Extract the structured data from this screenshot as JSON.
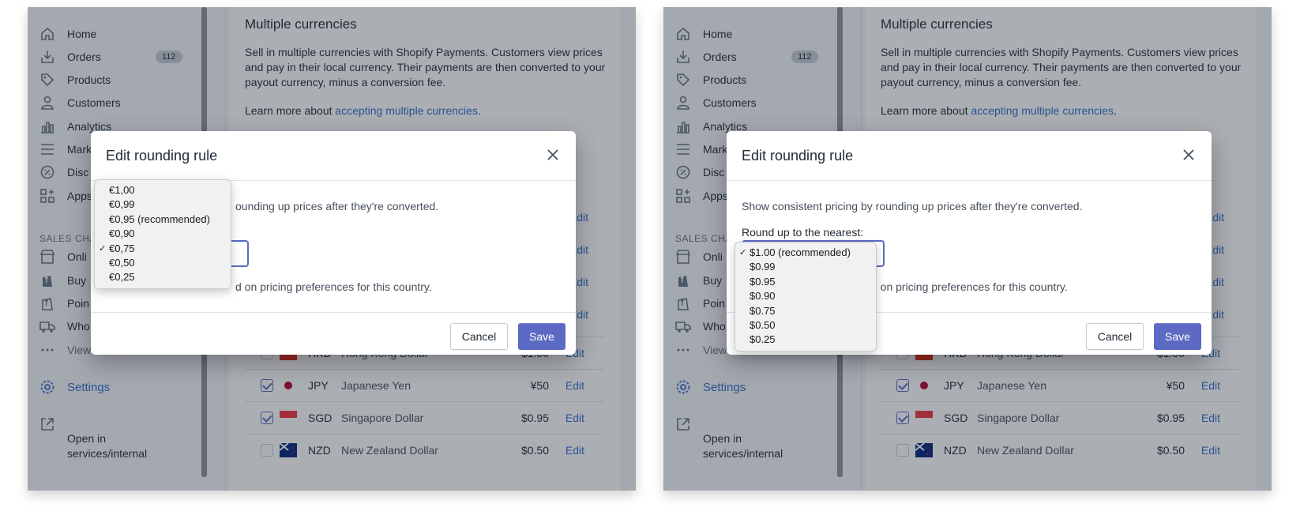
{
  "sidebar": {
    "items": [
      {
        "label": "Home",
        "icon": "home-icon"
      },
      {
        "label": "Orders",
        "icon": "orders-icon",
        "badge": "112"
      },
      {
        "label": "Products",
        "icon": "tag-icon"
      },
      {
        "label": "Customers",
        "icon": "person-icon"
      },
      {
        "label": "Analytics",
        "icon": "bar-chart-icon"
      },
      {
        "label": "Marketing",
        "icon": "menu-icon",
        "visible_label": "Mark"
      },
      {
        "label": "Discounts",
        "icon": "discount-icon",
        "visible_label": "Disc"
      },
      {
        "label": "Apps",
        "icon": "apps-icon"
      }
    ],
    "sales_channels_title": "SALES CHA",
    "channels": [
      {
        "label": "Onli",
        "icon": "store-icon"
      },
      {
        "label": "Buy",
        "icon": "shopify-bag-icon"
      },
      {
        "label": "Poin",
        "icon": "shopify-bag-icon"
      },
      {
        "label": "Who",
        "icon": "truck-icon"
      },
      {
        "label": "View",
        "icon": "ellipsis-icon"
      }
    ],
    "settings_label": "Settings",
    "open_in_label": "Open in services/internal"
  },
  "card": {
    "title": "Multiple currencies",
    "description": "Sell in multiple currencies with Shopify Payments. Customers view prices and pay in their local currency. Their payments are then converted to your payout currency, minus a conversion fee.",
    "learn_prefix": "Learn more about ",
    "learn_link": "accepting multiple currencies",
    "learn_suffix": ".",
    "edit_label": "Edit",
    "rows": [
      {
        "code": "HKD",
        "name": "Hong Kong Dollar",
        "price": "$1.00",
        "checked": false
      },
      {
        "code": "JPY",
        "name": "Japanese Yen",
        "price": "¥50",
        "checked": true
      },
      {
        "code": "SGD",
        "name": "Singapore Dollar",
        "price": "$0.95",
        "checked": true
      },
      {
        "code": "NZD",
        "name": "New Zealand Dollar",
        "price": "$0.50",
        "checked": false
      }
    ]
  },
  "modal": {
    "title": "Edit rounding rule",
    "body_left": "ounding up prices after they're converted.",
    "body_full": "Show consistent pricing by rounding up prices after they're converted.",
    "round_label": "Round up to the nearest:",
    "note_left": "d on pricing preferences for this country.",
    "cancel_label": "Cancel",
    "save_label": "Save"
  },
  "dropdown_eur": {
    "options": [
      "€1,00",
      "€0,99",
      "€0,95 (recommended)",
      "€0,90",
      "€0,75",
      "€0,50",
      "€0,25"
    ],
    "selected_index": 4
  },
  "dropdown_usd": {
    "options": [
      "$1.00 (recommended)",
      "$0.99",
      "$0.95",
      "$0.90",
      "$0.75",
      "$0.50",
      "$0.25"
    ],
    "selected_index": 0
  },
  "colors": {
    "accent": "#5c6ac4",
    "link": "#2c6ecb",
    "text": "#212b36"
  }
}
